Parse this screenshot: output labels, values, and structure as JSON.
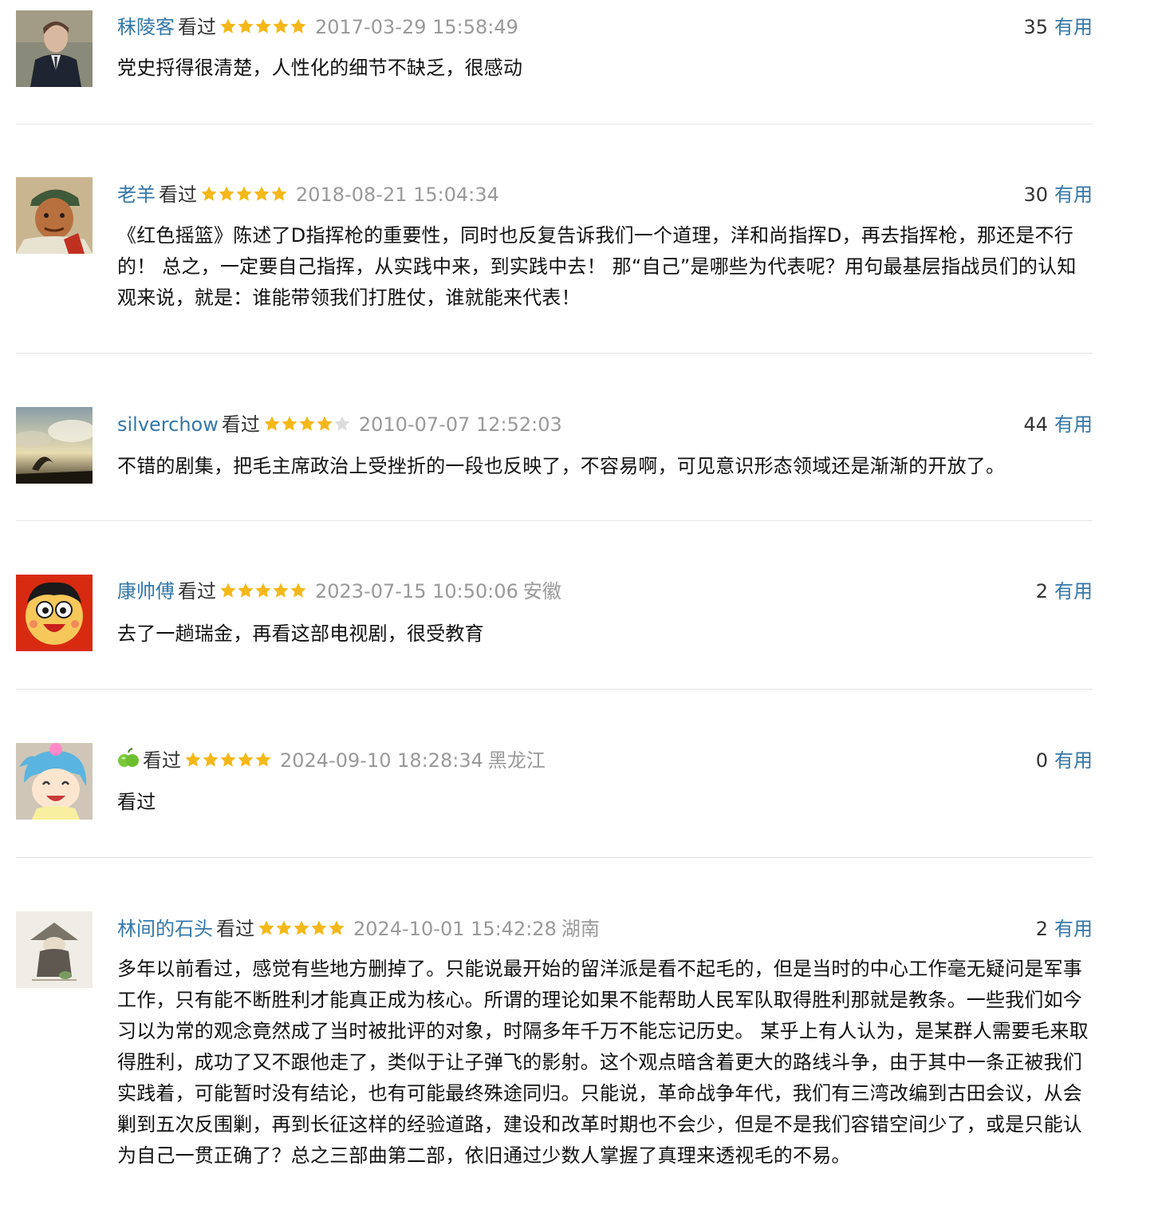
{
  "colors": {
    "link": "#3377aa",
    "meta": "#999999",
    "star": "#f5b81a",
    "star_empty": "#dddddd",
    "divider": "#e5e5e5"
  },
  "comments": [
    {
      "author": "秣陵客",
      "status": "看过",
      "rating": 5,
      "time": "2017-03-29 15:58:49",
      "location": "",
      "votes": "35",
      "vote_label": "有用",
      "text": "党史捋得很清楚，人性化的细节不缺乏，很感动"
    },
    {
      "author": "老羊",
      "status": "看过",
      "rating": 5,
      "time": "2018-08-21 15:04:34",
      "location": "",
      "votes": "30",
      "vote_label": "有用",
      "text": "《红色摇篮》陈述了D指挥枪的重要性，同时也反复告诉我们一个道理，洋和尚指挥D，再去指挥枪，那还是不行的！ 总之，一定要自己指挥，从实践中来，到实践中去！ 那“自己”是哪些为代表呢？用句最基层指战员们的认知观来说，就是：谁能带领我们打胜仗，谁就能来代表！"
    },
    {
      "author": "silverchow",
      "status": "看过",
      "rating": 4,
      "time": "2010-07-07 12:52:03",
      "location": "",
      "votes": "44",
      "vote_label": "有用",
      "text": "不错的剧集，把毛主席政治上受挫折的一段也反映了，不容易啊，可见意识形态领域还是渐渐的开放了。"
    },
    {
      "author": "康帅傅",
      "status": "看过",
      "rating": 5,
      "time": "2023-07-15 10:50:06",
      "location": "安徽",
      "votes": "2",
      "vote_label": "有用",
      "text": "去了一趟瑞金，再看这部电视剧，很受教育"
    },
    {
      "author": "",
      "author_icon": "green-apple-icon",
      "status": "看过",
      "rating": 5,
      "time": "2024-09-10 18:28:34",
      "location": "黑龙江",
      "votes": "0",
      "vote_label": "有用",
      "text": "看过"
    },
    {
      "author": "林间的石头",
      "status": "看过",
      "rating": 5,
      "time": "2024-10-01 15:42:28",
      "location": "湖南",
      "votes": "2",
      "vote_label": "有用",
      "text": "多年以前看过，感觉有些地方删掉了。只能说最开始的留洋派是看不起毛的，但是当时的中心工作毫无疑问是军事工作，只有能不断胜利才能真正成为核心。所谓的理论如果不能帮助人民军队取得胜利那就是教条。一些我们如今习以为常的观念竟然成了当时被批评的对象，时隔多年千万不能忘记历史。 某乎上有人认为，是某群人需要毛来取得胜利，成功了又不跟他走了，类似于让子弹飞的影射。这个观点暗含着更大的路线斗争，由于其中一条正被我们实践着，可能暂时没有结论，也有可能最终殊途同归。只能说，革命战争年代，我们有三湾改编到古田会议，从会剿到五次反围剿，再到长征这样的经验道路，建设和改革时期也不会少，但是不是我们容错空间少了，或是只能认为自己一贯正确了？总之三部曲第二部，依旧通过少数人掌握了真理来透视毛的不易。"
    }
  ]
}
